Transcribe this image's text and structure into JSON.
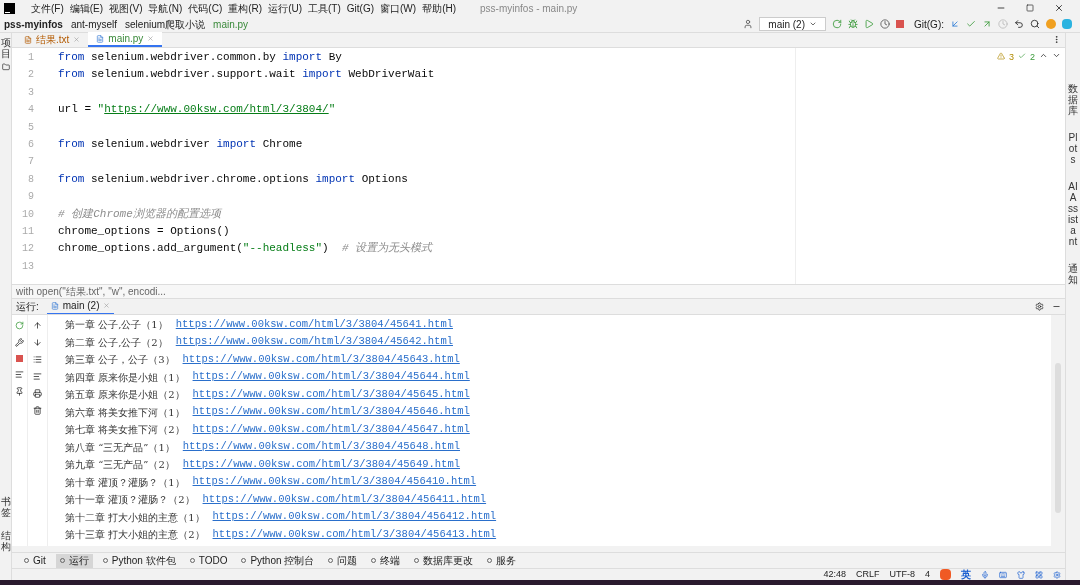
{
  "window": {
    "title": "pss-myinfos - main.py"
  },
  "menu": [
    "文件(F)",
    "编辑(E)",
    "视图(V)",
    "导航(N)",
    "代码(C)",
    "重构(R)",
    "运行(U)",
    "工具(T)",
    "Git(G)",
    "窗口(W)",
    "帮助(H)"
  ],
  "breadcrumbs": [
    {
      "label": "pss-myinfos",
      "kind": "project"
    },
    {
      "label": "ant-myself",
      "kind": "folder"
    },
    {
      "label": "selenium爬取小说",
      "kind": "folder"
    },
    {
      "label": "main.py",
      "kind": "file"
    }
  ],
  "run_config": "main (2)",
  "git_label": "Git(G):",
  "left_strip": {
    "top": "项目",
    "bottom": [
      "书签",
      "结构"
    ]
  },
  "right_strip": [
    "数据库",
    "Plots",
    "AI Assistant",
    "通知"
  ],
  "tabs": [
    {
      "label": "结果.txt",
      "kind": "txt",
      "selected": false
    },
    {
      "label": "main.py",
      "kind": "py",
      "selected": true
    }
  ],
  "inspections": {
    "warnings": "3",
    "ok": "2"
  },
  "code": [
    {
      "n": "1",
      "tokens": [
        {
          "kind": "kw",
          "t": "from"
        },
        {
          "kind": "plain",
          "t": " selenium.webdriver.common.by "
        },
        {
          "kind": "kw",
          "t": "import"
        },
        {
          "kind": "plain",
          "t": " By"
        }
      ]
    },
    {
      "n": "2",
      "tokens": [
        {
          "kind": "kw",
          "t": "from"
        },
        {
          "kind": "plain",
          "t": " selenium.webdriver.support.wait "
        },
        {
          "kind": "kw",
          "t": "import"
        },
        {
          "kind": "plain",
          "t": " WebDriverWait"
        }
      ]
    },
    {
      "n": "3"
    },
    {
      "n": "4",
      "tokens": [
        {
          "kind": "plain",
          "t": "url = "
        },
        {
          "kind": "str",
          "t": "\""
        },
        {
          "kind": "url",
          "t": "https://www.00ksw.com/html/3/3804/"
        },
        {
          "kind": "str",
          "t": "\""
        }
      ]
    },
    {
      "n": "5"
    },
    {
      "n": "6",
      "tokens": [
        {
          "kind": "kw",
          "t": "from"
        },
        {
          "kind": "plain",
          "t": " selenium.webdriver "
        },
        {
          "kind": "kw",
          "t": "import"
        },
        {
          "kind": "plain",
          "t": " Chrome"
        }
      ]
    },
    {
      "n": "7"
    },
    {
      "n": "8",
      "tokens": [
        {
          "kind": "kw",
          "t": "from"
        },
        {
          "kind": "plain",
          "t": " selenium.webdriver.chrome.options "
        },
        {
          "kind": "kw",
          "t": "import"
        },
        {
          "kind": "plain",
          "t": " Options"
        }
      ]
    },
    {
      "n": "9"
    },
    {
      "n": "10",
      "tokens": [
        {
          "kind": "comment",
          "t": "# 创建Chrome浏览器的配置选项"
        }
      ]
    },
    {
      "n": "11",
      "tokens": [
        {
          "kind": "plain",
          "t": "chrome_options = Options()"
        }
      ]
    },
    {
      "n": "12",
      "tokens": [
        {
          "kind": "plain",
          "t": "chrome_options.add_argument("
        },
        {
          "kind": "str",
          "t": "\"--headless\""
        },
        {
          "kind": "plain",
          "t": ")  "
        },
        {
          "kind": "comment",
          "t": "# 设置为无头模式"
        }
      ]
    },
    {
      "n": "13"
    }
  ],
  "code_context": "with open(\"结果.txt\", \"w\", encodi...",
  "run_panel": {
    "label": "运行:",
    "tab": "main (2)"
  },
  "output": [
    {
      "title": "第一章 公子,公子（1）",
      "url": "https://www.00ksw.com/html/3/3804/45641.html"
    },
    {
      "title": "第二章 公子,公子（2）",
      "url": "https://www.00ksw.com/html/3/3804/45642.html"
    },
    {
      "title": "第三章 公子，公子（3）",
      "url": "https://www.00ksw.com/html/3/3804/45643.html"
    },
    {
      "title": "第四章 原来你是小姐（1）",
      "url": "https://www.00ksw.com/html/3/3804/45644.html"
    },
    {
      "title": "第五章 原来你是小姐（2）",
      "url": "https://www.00ksw.com/html/3/3804/45645.html"
    },
    {
      "title": "第六章 将美女推下河（1）",
      "url": "https://www.00ksw.com/html/3/3804/45646.html"
    },
    {
      "title": "第七章 将美女推下河（2）",
      "url": "https://www.00ksw.com/html/3/3804/45647.html"
    },
    {
      "title": "第八章 “三无产品”（1）",
      "url": "https://www.00ksw.com/html/3/3804/45648.html"
    },
    {
      "title": "第九章 “三无产品”（2）",
      "url": "https://www.00ksw.com/html/3/3804/45649.html"
    },
    {
      "title": "第十章 灌顶？灌肠？（1）",
      "url": "https://www.00ksw.com/html/3/3804/456410.html"
    },
    {
      "title": "第十一章 灌顶？灌肠？（2）",
      "url": "https://www.00ksw.com/html/3/3804/456411.html"
    },
    {
      "title": "第十二章 打大小姐的主意（1）",
      "url": "https://www.00ksw.com/html/3/3804/456412.html"
    },
    {
      "title": "第十三章 打大小姐的主意（2）",
      "url": "https://www.00ksw.com/html/3/3804/456413.html"
    }
  ],
  "tool_tabs": [
    {
      "label": "Git",
      "selected": false
    },
    {
      "label": "运行",
      "selected": true
    },
    {
      "label": "Python 软件包",
      "selected": false
    },
    {
      "label": "TODO",
      "selected": false
    },
    {
      "label": "Python 控制台",
      "selected": false
    },
    {
      "label": "问题",
      "selected": false
    },
    {
      "label": "终端",
      "selected": false
    },
    {
      "label": "数据库更改",
      "selected": false
    },
    {
      "label": "服务",
      "selected": false
    }
  ],
  "status_bar": [
    "42:48",
    "CRLF",
    "UTF-8",
    "4"
  ],
  "ime": {
    "label": "英"
  }
}
